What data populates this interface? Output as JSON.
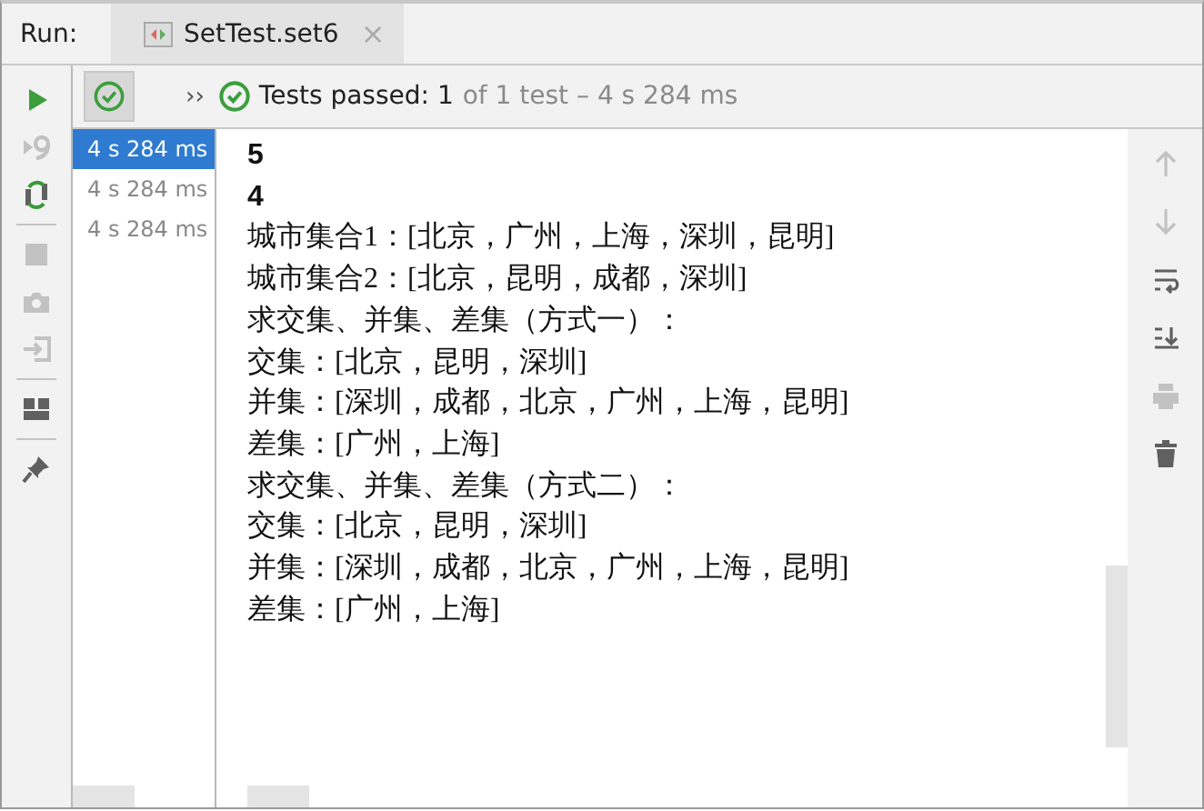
{
  "tool_window": {
    "label": "Run:",
    "tabs": [
      {
        "label": "SetTest.set6",
        "selected": true,
        "close": "×"
      }
    ]
  },
  "left_toolbar": [
    {
      "kind": "run",
      "disabled": false
    },
    {
      "kind": "rerun",
      "disabled": true
    },
    {
      "kind": "toggle",
      "disabled": false
    },
    {
      "kind": "separator"
    },
    {
      "kind": "stop",
      "disabled": true
    },
    {
      "kind": "camera",
      "disabled": true
    },
    {
      "kind": "exit",
      "disabled": true
    },
    {
      "kind": "separator"
    },
    {
      "kind": "layout",
      "disabled": false
    },
    {
      "kind": "separator"
    },
    {
      "kind": "pin",
      "disabled": false
    }
  ],
  "test_header": {
    "passed_filter": {
      "selected": true
    },
    "expand": "››",
    "status": "Tests passed: 1",
    "detail": "of 1 test – 4 s 284 ms"
  },
  "test_list": [
    {
      "time": "4 s 284 ms",
      "selected": true
    },
    {
      "time": "4 s 284 ms",
      "selected": false
    },
    {
      "time": "4 s 284 ms",
      "selected": false
    }
  ],
  "console_lines": [
    {
      "text": "5",
      "kind": "number"
    },
    {
      "text": "4",
      "kind": "number"
    },
    {
      "text": "城市集合1：[北京，广州，上海，深圳，昆明]",
      "kind": "text"
    },
    {
      "text": "城市集合2：[北京，昆明，成都，深圳]",
      "kind": "text"
    },
    {
      "text": "求交集、并集、差集（方式一）：",
      "kind": "text"
    },
    {
      "text": "交集：[北京，昆明，深圳]",
      "kind": "text"
    },
    {
      "text": "并集：[深圳，成都，北京，广州，上海，昆明]",
      "kind": "text"
    },
    {
      "text": "差集：[广州，上海]",
      "kind": "text"
    },
    {
      "text": "求交集、并集、差集（方式二）：",
      "kind": "text"
    },
    {
      "text": "交集：[北京，昆明，深圳]",
      "kind": "text"
    },
    {
      "text": "并集：[深圳，成都，北京，广州，上海，昆明]",
      "kind": "text"
    },
    {
      "text": "差集：[广州，上海]",
      "kind": "text"
    }
  ],
  "right_toolbar": [
    {
      "kind": "up",
      "disabled": true
    },
    {
      "kind": "down",
      "disabled": true
    },
    {
      "kind": "wrap",
      "disabled": false
    },
    {
      "kind": "scroll-end",
      "disabled": false
    },
    {
      "kind": "print",
      "disabled": true
    },
    {
      "kind": "trash",
      "disabled": false
    }
  ]
}
